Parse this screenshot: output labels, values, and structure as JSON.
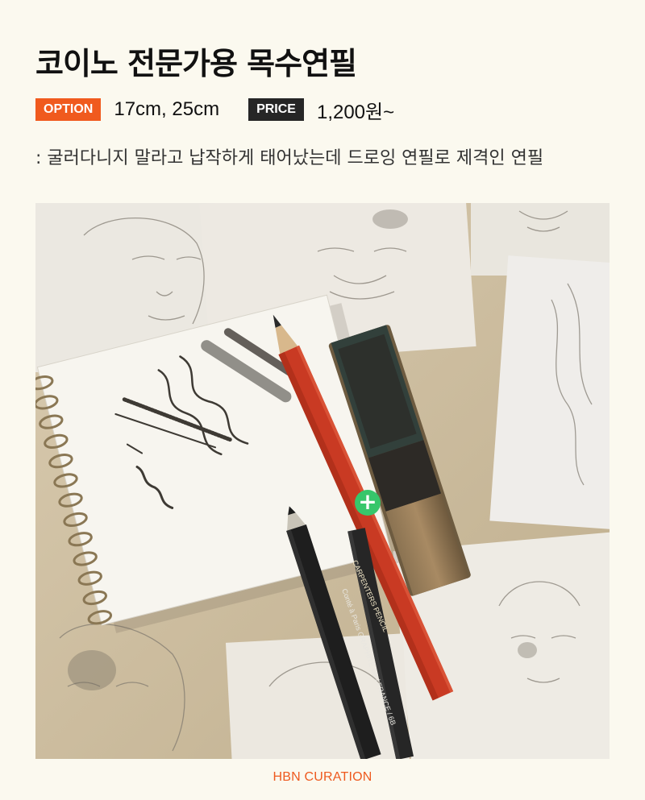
{
  "product": {
    "title": "코이노 전문가용 목수연필",
    "option_badge": "OPTION",
    "option_value": "17cm, 25cm",
    "price_badge": "PRICE",
    "price_value": "1,200원~",
    "description": ": 굴러다니지 말라고 납작하게 태어났는데 드로잉 연필로 제격인 연필"
  },
  "photo": {
    "pencil_red_text": "CARPENTERS PENCIL",
    "pencil_black_text": "Conté à Paris  GRAPHITE 6B / FRANCE / 6B",
    "plus_symbol": "+"
  },
  "footer": {
    "label": "HBN CURATION"
  },
  "colors": {
    "background": "#fbf9ef",
    "option_badge": "#f05a1e",
    "price_badge": "#262626",
    "plus_button": "#37c66b",
    "footer_text": "#ee5a1f"
  }
}
